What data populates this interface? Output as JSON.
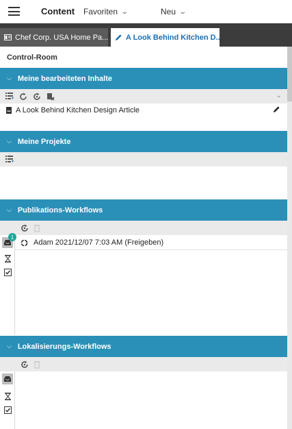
{
  "topbar": {
    "title": "Content",
    "nav": [
      {
        "label": "Favoriten"
      },
      {
        "label": "Neu"
      }
    ]
  },
  "tabs": [
    {
      "label": "Chef Corp. USA Home Pa...",
      "active": false
    },
    {
      "label": "A Look Behind Kitchen D...",
      "active": true,
      "close": "×"
    }
  ],
  "page_title": "Control-Room",
  "sections": {
    "edited": {
      "title": "Meine bearbeiteten Inhalte",
      "items": [
        {
          "label": "A Look Behind Kitchen Design Article"
        }
      ]
    },
    "projects": {
      "title": "Meine Projekte"
    },
    "publication": {
      "title": "Publikations-Workflows",
      "badge": "1",
      "items": [
        {
          "label": "Adam 2021/12/07 7:03 AM (Freigeben)"
        }
      ]
    },
    "localization": {
      "title": "Lokalisierungs-Workflows"
    }
  },
  "colors": {
    "section_header": "#2a90b8",
    "tab_active_text": "#1a6fb3",
    "tabbar_bg": "#3c3c3c",
    "badge": "#1fa69a"
  }
}
